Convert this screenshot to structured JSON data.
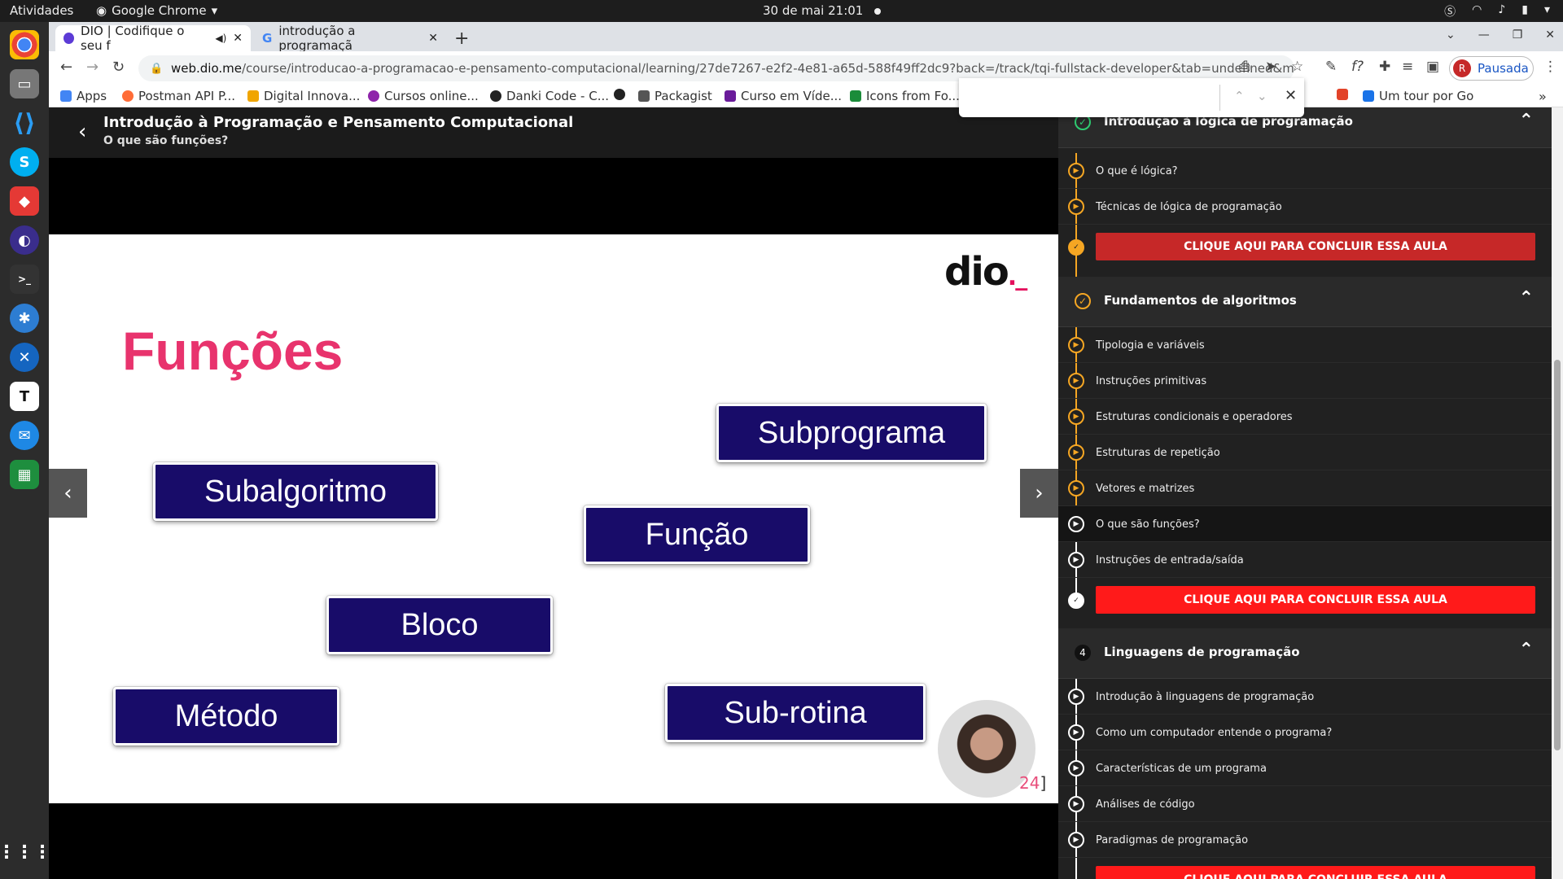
{
  "system": {
    "activities": "Atividades",
    "app": "Google Chrome",
    "clock": "30 de mai  21:01"
  },
  "browser": {
    "tabs": [
      {
        "label": "DIO | Codifique o seu f",
        "active": true
      },
      {
        "label": "introdução a programaçã",
        "active": false
      }
    ],
    "url_host": "web.dio.me",
    "url_path": "/course/introducao-a-programacao-e-pensamento-computacional/learning/27de7267-e2f2-4e81-a65d-588f49ff2dc9?back=/track/tqi-fullstack-developer&tab=undefined&moduleId=undefined",
    "profile_initial": "R",
    "profile_label": "Pausada",
    "bookmarks": [
      {
        "label": "Apps",
        "color": "#4285f4"
      },
      {
        "label": "Postman API P...",
        "color": "#ff6c37"
      },
      {
        "label": "Digital Innova...",
        "color": "#f0a500"
      },
      {
        "label": "Cursos online...",
        "color": "#8e24aa"
      },
      {
        "label": "Danki Code - C...",
        "color": "#222222"
      },
      {
        "label": "Packagist",
        "color": "#555555"
      },
      {
        "label": "Curso em Víde...",
        "color": "#6a1b9a"
      },
      {
        "label": "Icons from Fo...",
        "color": "#1b8c3a"
      },
      {
        "label": "Um tour por Go",
        "color": "#1a73e8"
      }
    ]
  },
  "course": {
    "title": "Introdução à Programação e Pensamento Computacional",
    "current_lesson": "O que são funções?"
  },
  "slide": {
    "logo": "dio",
    "title": "Funções",
    "terms": [
      "Subprograma",
      "Subalgoritmo",
      "Função",
      "Bloco",
      "Método",
      "Sub-rotina"
    ],
    "page_number": "24",
    "page_bracket": "]"
  },
  "sidebar": {
    "cta_label": "CLIQUE AQUI PARA CONCLUIR ESSA AULA",
    "modules": [
      {
        "title": "Introdução à lógica de programação",
        "lessons": [
          "O que é lógica?",
          "Técnicas de lógica de programação"
        ]
      },
      {
        "title": "Fundamentos de algoritmos",
        "lessons": [
          "Tipologia e variáveis",
          "Instruções primitivas",
          "Estruturas condicionais e operadores",
          "Estruturas de repetição",
          "Vetores e matrizes",
          "O que são funções?",
          "Instruções de entrada/saída"
        ]
      },
      {
        "number": "4",
        "title": "Linguagens de programação",
        "lessons": [
          "Introdução à linguagens de programação",
          "Como um computador entende o programa?",
          "Características de um programa",
          "Análises de código",
          "Paradigmas de programação"
        ]
      }
    ],
    "colors": {
      "cta_dark": "#c62828",
      "cta": "#ff1a1a",
      "accent": "#f5a623"
    }
  }
}
